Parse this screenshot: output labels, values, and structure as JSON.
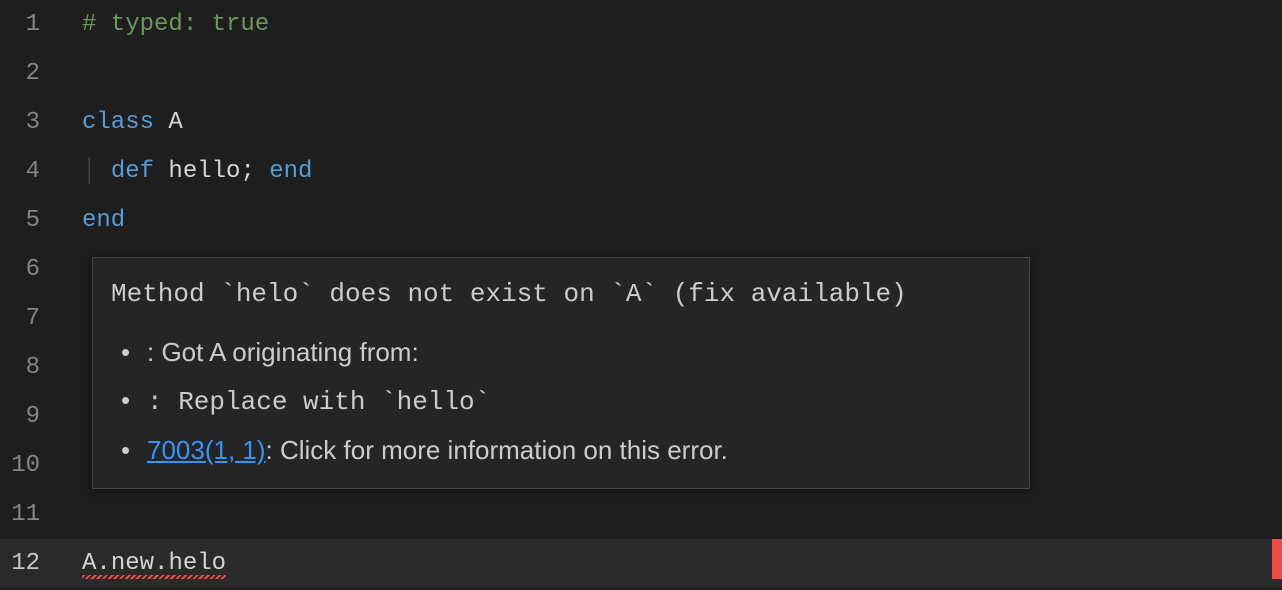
{
  "lineNumbers": [
    "1",
    "2",
    "3",
    "4",
    "5",
    "6",
    "7",
    "8",
    "9",
    "10",
    "11",
    "12"
  ],
  "activeLine": "12",
  "tokens": {
    "l1_comment": "# typed: true",
    "l3_kw": "class ",
    "l3_name": "A",
    "l4_kw_def": "def ",
    "l4_name": "hello",
    "l4_semi": "; ",
    "l4_kw_end": "end",
    "l5_kw": "end",
    "l12_recv": "A",
    "l12_dot1": ".",
    "l12_new": "new",
    "l12_dot2": ".",
    "l12_call": "helo"
  },
  "hover": {
    "message": "Method `helo` does not exist on `A` (fix available)",
    "items": [
      {
        "text": ": Got A originating from:"
      },
      {
        "text": ": Replace with `hello`"
      },
      {
        "link": "7003(1, 1)",
        "text": ": Click for more information on this error."
      }
    ]
  }
}
